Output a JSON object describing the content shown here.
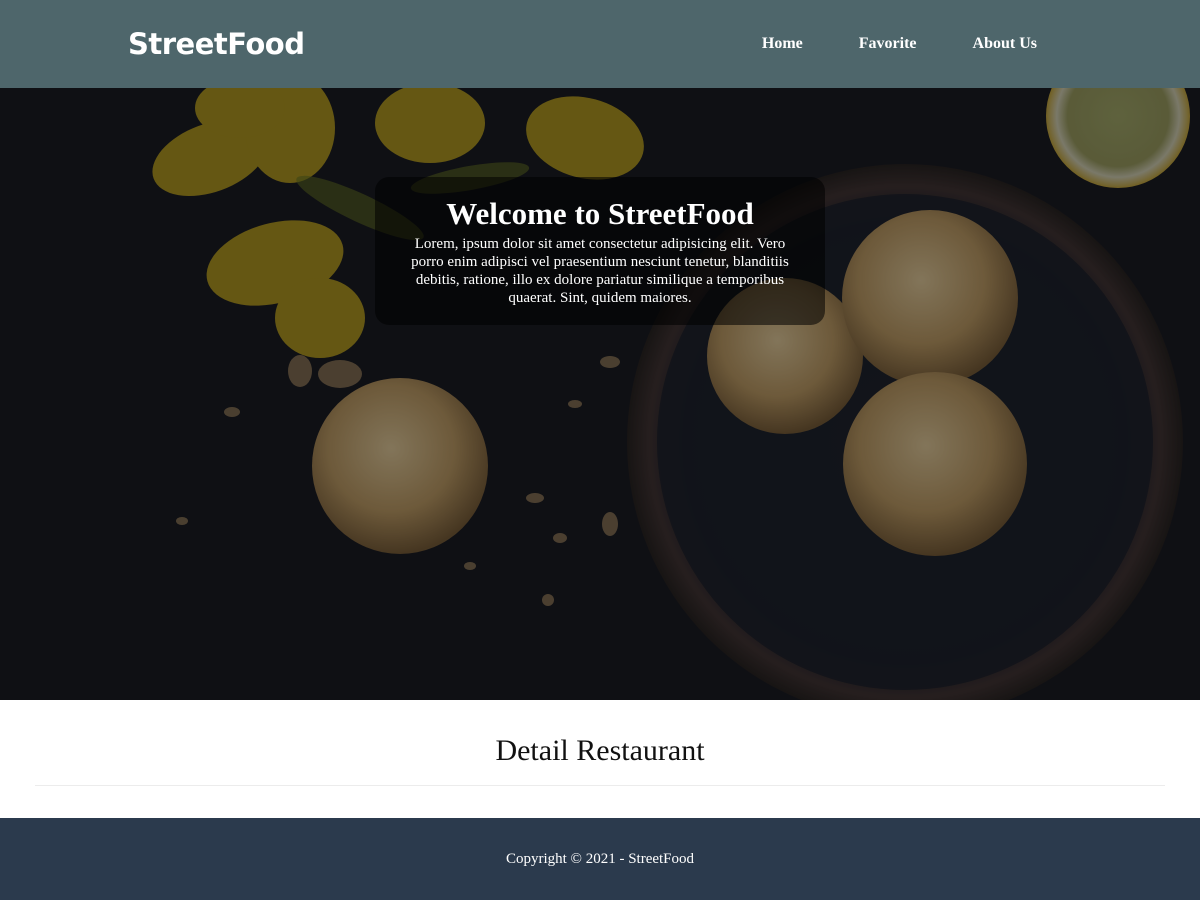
{
  "header": {
    "brand": "StreetFood",
    "nav": [
      {
        "label": "Home"
      },
      {
        "label": "Favorite"
      },
      {
        "label": "About Us"
      }
    ],
    "background_color": "#4e666b"
  },
  "hero": {
    "title": "Welcome to StreetFood",
    "text": "Lorem, ipsum dolor sit amet consectetur adipisicing elit. Vero porro enim adipisci vel praesentium nesciunt tenetur, blanditiis debitis, ratione, illo ex dolore pariatur similique a temporibus quaerat. Sint, quidem maiores.",
    "image_icon": "food-photo-cookies-flowers-lemon"
  },
  "content": {
    "section_title": "Detail Restaurant"
  },
  "footer": {
    "copyright": "Copyright © 2021 - StreetFood",
    "background_color": "#2b3a4d"
  }
}
